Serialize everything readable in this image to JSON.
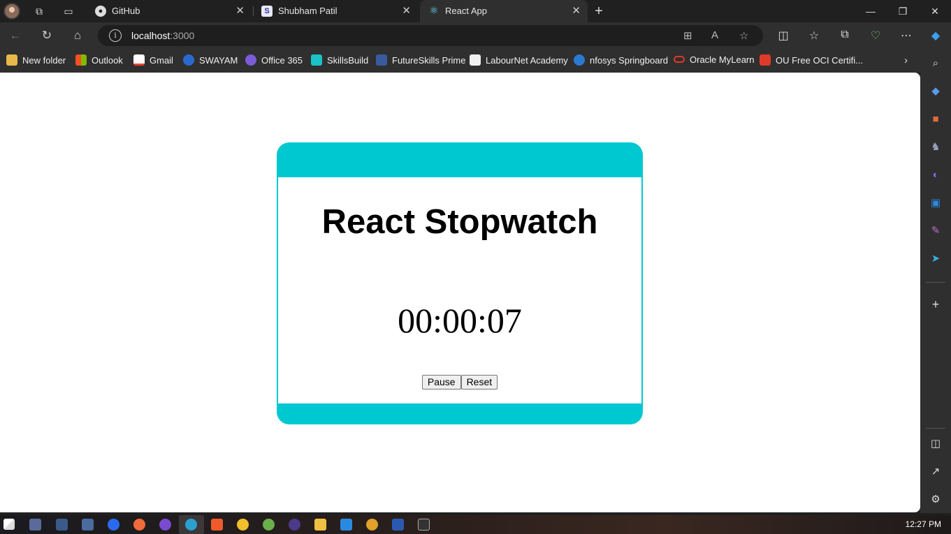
{
  "browser": {
    "tabs": [
      {
        "label": "GitHub",
        "favicon": "github-icon"
      },
      {
        "label": "Shubham Patil",
        "favicon": "s-logo-icon"
      },
      {
        "label": "React App",
        "favicon": "react-icon",
        "active": true
      }
    ],
    "new_tab_symbol": "+",
    "address": {
      "host": "localhost",
      "port": ":3000"
    },
    "bookmarks": [
      {
        "label": "New folder",
        "icon": "folder-icon",
        "color": "#e8b84a"
      },
      {
        "label": "Outlook",
        "icon": "microsoft-icon",
        "color": "#f25022"
      },
      {
        "label": "Gmail",
        "icon": "gmail-icon",
        "color": "#ea4335"
      },
      {
        "label": "SWAYAM",
        "icon": "swayam-icon",
        "color": "#2a6ad0"
      },
      {
        "label": "Office 365",
        "icon": "office-icon",
        "color": "#7b5cd6"
      },
      {
        "label": "SkillsBuild",
        "icon": "ibm-icon",
        "color": "#19c3c8"
      },
      {
        "label": "FutureSkills Prime",
        "icon": "futureskills-icon",
        "color": "#3a5aa0"
      },
      {
        "label": "LabourNet Academy",
        "icon": "page-icon",
        "color": "#f0f0f0"
      },
      {
        "label": "nfosys Springboard",
        "icon": "springboard-icon",
        "color": "#2a7ad0"
      },
      {
        "label": "Oracle MyLearn",
        "icon": "oracle-icon",
        "color": "#e03a2a"
      },
      {
        "label": "OU Free OCI Certifi...",
        "icon": "oracle-badge-icon",
        "color": "#e03a2a"
      }
    ]
  },
  "app": {
    "title": "React Stopwatch",
    "time": "00:00:07",
    "buttons": {
      "pause": "Pause",
      "reset": "Reset"
    },
    "accent_color": "#00c8d0"
  },
  "taskbar": {
    "clock": "12:27 PM"
  }
}
